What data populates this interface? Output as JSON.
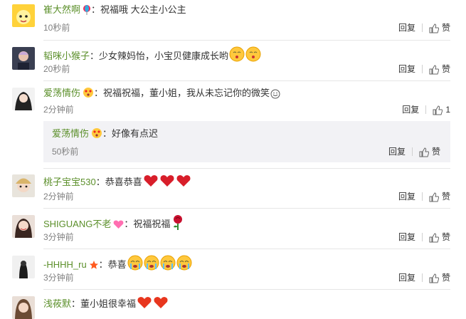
{
  "comments": [
    {
      "user": "崔大然啊",
      "text": "：祝福哦  大公主小公主",
      "time": "10秒前",
      "reply": "回复",
      "like": "赞"
    },
    {
      "user": "韬咪小猴子",
      "text": "：少女辣妈怡，小宝贝健康成长哟",
      "time": "20秒前",
      "reply": "回复",
      "like": "赞"
    },
    {
      "user": "爱荡情伤",
      "text": "：祝福祝福，董小姐，我从未忘记你的微笑",
      "time": "2分钟前",
      "reply": "回复",
      "like_count": "1"
    },
    {
      "user": "桃子宝宝530",
      "text": "：恭喜恭喜",
      "time": "2分钟前",
      "reply": "回复",
      "like": "赞"
    },
    {
      "user": "SHIGUANG不老",
      "text": "：祝福祝福",
      "time": "3分钟前",
      "reply": "回复",
      "like": "赞"
    },
    {
      "user": "-HHHH_ru",
      "text": "：恭喜",
      "time": "3分钟前",
      "reply": "回复",
      "like": "赞"
    },
    {
      "user": "浅莜默",
      "text": "：董小姐很幸福"
    }
  ],
  "nested_reply": {
    "user": "爱荡情伤",
    "text": "：好像有点迟",
    "time": "50秒前",
    "reply": "回复",
    "like": "赞"
  },
  "colors": {
    "username": "#5b8f2a",
    "time": "#808080",
    "reply_bg": "#f2f2f5"
  }
}
